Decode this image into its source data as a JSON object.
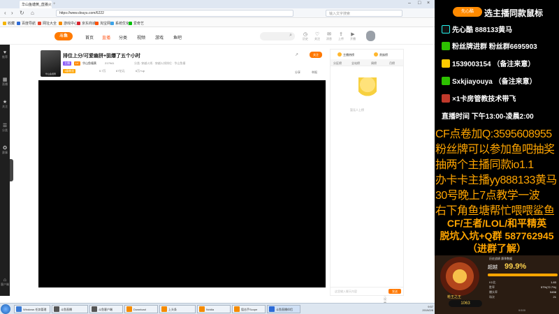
{
  "browser": {
    "tabs": [
      {
        "label": "华山鱼塘黄_直播火拼团"
      },
      {
        "label": "+"
      }
    ],
    "url": "https://www.douyu.com/6222",
    "search_placeholder": "输入文字搜索"
  },
  "bookmarks": [
    "收藏",
    "百度导航",
    "网址大全",
    "游戏中心",
    "京东商城",
    "淘宝网",
    "系统优化",
    "爱奇艺"
  ],
  "site": {
    "logo": "斗鱼",
    "nav": [
      "首页",
      "直播",
      "分类",
      "视频",
      "游戏",
      "鱼吧"
    ],
    "top_icons": [
      {
        "name": "history-icon",
        "glyph": "◷",
        "label": "历史"
      },
      {
        "name": "follow-icon",
        "glyph": "♡",
        "label": "关注"
      },
      {
        "name": "message-icon",
        "glyph": "✉",
        "label": "消息"
      },
      {
        "name": "upload-icon",
        "glyph": "⇪",
        "label": "上传"
      },
      {
        "name": "live-icon",
        "glyph": "▶",
        "label": "开播"
      }
    ]
  },
  "sidebar": [
    {
      "name": "sidebar-item-recommend",
      "glyph": "♥",
      "label": "推荐"
    },
    {
      "name": "sidebar-item-live",
      "glyph": "▦",
      "label": "直播"
    },
    {
      "name": "sidebar-item-follow",
      "glyph": "★",
      "label": "关注"
    },
    {
      "name": "sidebar-item-category",
      "glyph": "☰",
      "label": "分类"
    },
    {
      "name": "sidebar-item-match",
      "glyph": "✪",
      "label": "赛事"
    },
    {
      "name": "sidebar-item-client",
      "glyph": "⌂",
      "label": "客户端"
    }
  ],
  "room": {
    "title": "排位上分/可爱幽拼+狙爆了五个小时",
    "meta": [
      "分类:",
      "穿越火线",
      "·",
      "穿越火线排位",
      "·",
      "华山鱼塘"
    ],
    "badges": [
      "主播",
      "LV"
    ],
    "anchor": "华山鱼塘黄",
    "hot": "217941",
    "level_chip": "1级粉丝",
    "stats": [
      "0.7万",
      "67亿元",
      "6万+up"
    ],
    "follow_label": "关注",
    "share_label": "分享",
    "report": "举报"
  },
  "below_video": {
    "barrage": "弹幕设置"
  },
  "right_panel": {
    "tabs": [
      "主播热榜",
      "贵族榜"
    ],
    "rank_tabs": [
      "分区榜",
      "全站榜",
      "周榜",
      "月榜"
    ],
    "mascot_caption": "暂无人上榜",
    "chat_placeholder": "这里输入聊天内容",
    "send": "发送"
  },
  "taskbar": {
    "items": [
      "Windows 任务管理",
      "斗鱼直播",
      "斗鱼客户端",
      "Download",
      "上头条",
      "Nvidia",
      "狙击手Scope",
      "斗鱼直播伴侣"
    ],
    "time": "9:57",
    "date": "2019/2/8"
  },
  "overlay": {
    "brand": "先心酷",
    "top": "选主播同款鼠标",
    "lines": [
      {
        "icon": "tiktok-icon",
        "text": "先心酷  888133黄马"
      },
      {
        "icon": "wechat-icon",
        "text": "粉丝牌进群  粉丝群6695903"
      },
      {
        "icon": "phone-icon",
        "text": "1539003154 （备注来意）"
      },
      {
        "icon": "chat-icon",
        "text": "Sxkjiayouya （备注来意）"
      },
      {
        "icon": "rocket-icon",
        "text": "×1卡房管教技术带飞"
      }
    ],
    "live_time": "直播时间 下午13:00-凌晨2:00",
    "ads": [
      "CF点卷加Q:3595608955",
      "粉丝牌可以参加鱼吧抽奖",
      "抽两个主播同款io1.1",
      "办卡卡主播yy888133黄马",
      "30号晚上7点教学一波",
      "右下角鱼塘帮忙喂喂鲨鱼"
    ],
    "cf": [
      "CF/王者/LOL/和平精英",
      "脱坑入坑+Q群 587762945",
      "（进群了解）"
    ]
  },
  "rank_panel": {
    "tabs": [
      "历史战绩",
      "赛季数据"
    ],
    "title": "超越",
    "percent": "99.9%",
    "percent_value": 0.999,
    "emblem_name": "枪王之王",
    "stats": [
      {
        "label": "KD比",
        "value": "1.83"
      },
      {
        "label": "胜率",
        "value": "57%(72.7%)"
      },
      {
        "label": "爆头率",
        "value": "5498"
      },
      {
        "label": "场次",
        "value": "21"
      }
    ],
    "coin": "1063",
    "score": "0/100"
  }
}
